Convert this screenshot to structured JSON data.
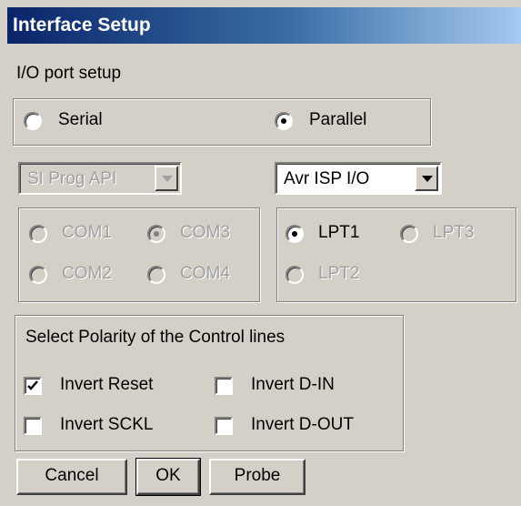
{
  "window": {
    "title": "Interface Setup"
  },
  "io_port_setup_label": "I/O port setup",
  "port_type": {
    "serial_label": "Serial",
    "parallel_label": "Parallel",
    "selected": "Parallel"
  },
  "serial": {
    "api_select_value": "SI Prog API",
    "ports": [
      {
        "label": "COM1",
        "selected": false
      },
      {
        "label": "COM3",
        "selected": true
      },
      {
        "label": "COM2",
        "selected": false
      },
      {
        "label": "COM4",
        "selected": false
      }
    ]
  },
  "parallel": {
    "api_select_value": "Avr ISP I/O",
    "ports": [
      {
        "label": "LPT1",
        "selected": true
      },
      {
        "label": "LPT3",
        "selected": false
      },
      {
        "label": "LPT2",
        "selected": false
      }
    ]
  },
  "polarity": {
    "title": "Select Polarity of the Control lines",
    "invert_reset": {
      "label": "Invert Reset",
      "checked": true
    },
    "invert_din": {
      "label": "Invert D-IN",
      "checked": false
    },
    "invert_sckl": {
      "label": "Invert SCKL",
      "checked": false
    },
    "invert_dout": {
      "label": "Invert D-OUT",
      "checked": false
    }
  },
  "buttons": {
    "cancel": "Cancel",
    "ok": "OK",
    "probe": "Probe"
  }
}
